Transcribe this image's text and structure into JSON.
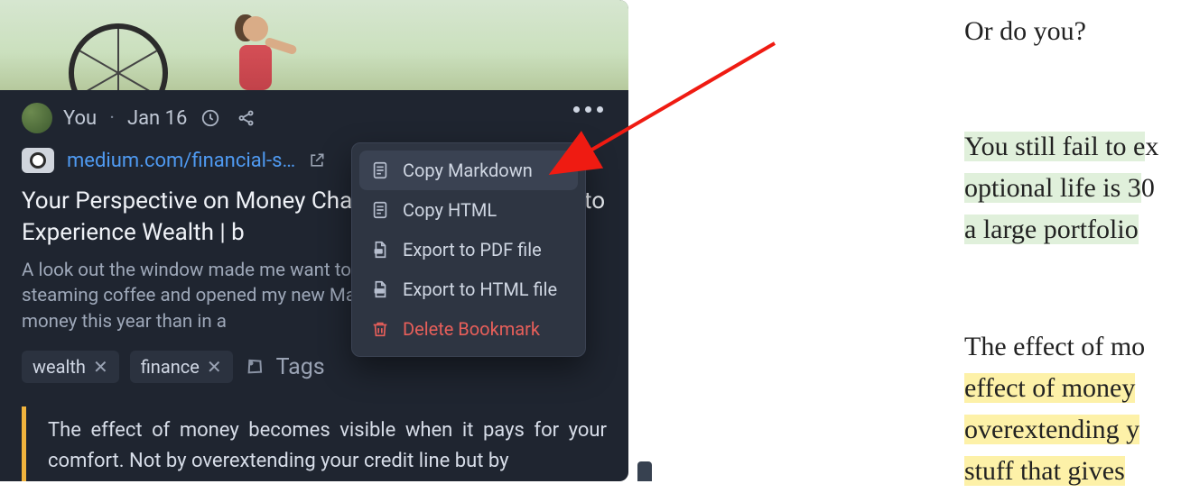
{
  "meta": {
    "author": "You",
    "date": "Jan 16"
  },
  "link": {
    "url_display": "medium.com/financial-s…"
  },
  "article": {
    "title": "Your Perspective on Money Changes When You Begin to Experience Wealth | b",
    "description": "A look out the window made me want to stay inside. So I got a steaming coffee and opened my new Mac. I learned more about money this year than in a"
  },
  "tags": {
    "items": [
      "wealth",
      "finance"
    ],
    "label": "Tags"
  },
  "quote": {
    "text": "The effect of money becomes visible when it pays for your comfort. Not by overextending your credit line but by"
  },
  "menu": {
    "copy_markdown": "Copy Markdown",
    "copy_html": "Copy HTML",
    "export_pdf": "Export to PDF file",
    "export_html": "Export to HTML file",
    "delete_bookmark": "Delete Bookmark"
  },
  "reader": {
    "line1": "Or do you?",
    "line2a": "You still fail to e",
    "line2b": "x",
    "line3a": "optional life is 3",
    "line3b": "0",
    "line4": "a large portfolio ",
    "line5": "The effect of mo",
    "line6": "effect of money ",
    "line7": "overextending y",
    "line8": "stuff that gives "
  }
}
